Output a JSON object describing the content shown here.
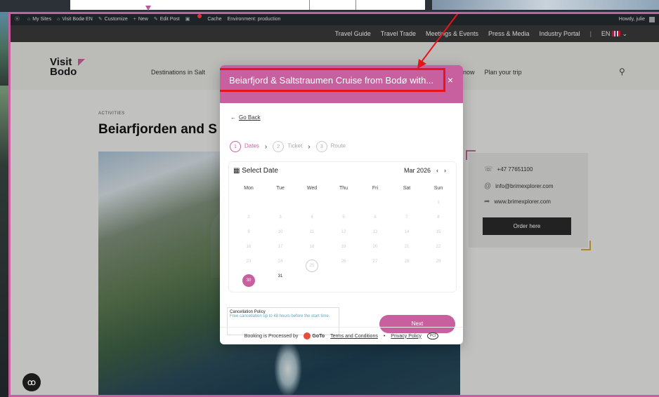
{
  "admin_bar": {
    "items": [
      "My Sites",
      "Visit Bodø EN",
      "Customize",
      "New",
      "Edit Post",
      "Cache",
      "Environment: production"
    ],
    "greeting": "Howdy, julie"
  },
  "top_nav": {
    "items": [
      "Travel Guide",
      "Travel Trade",
      "Meetings & Events",
      "Press & Media",
      "Industry Portal"
    ],
    "language": "EN"
  },
  "header": {
    "logo_line1": "Visit",
    "logo_line2": "Bodo",
    "nav_left": "Destinations in Salt",
    "nav_right": [
      "now",
      "Plan your trip"
    ]
  },
  "page": {
    "category": "ACTIVITIES",
    "title": "Beiarfjorden and S"
  },
  "contact": {
    "phone": "+47 77651100",
    "email": "info@brimexplorer.com",
    "website": "www.brimexplorer.com",
    "order_label": "Order here"
  },
  "modal": {
    "title": "Beiarfjord & Saltstraumen Cruise from Bodø with...",
    "close": "×",
    "back_label": "Go Back",
    "steps": [
      {
        "num": "1",
        "label": "Dates"
      },
      {
        "num": "2",
        "label": "Ticket"
      },
      {
        "num": "3",
        "label": "Route"
      }
    ],
    "calendar": {
      "heading": "Select Date",
      "month": "Mar 2026",
      "weekdays": [
        "Mon",
        "Tue",
        "Wed",
        "Thu",
        "Fri",
        "Sat",
        "Sun"
      ],
      "selected": "30",
      "today": "25"
    },
    "policy_title": "Cancellation Policy",
    "policy_text": "Free cancellation up to 48 hours before the start time.",
    "next_label": "Next",
    "footer": {
      "processed_by": "Booking is Processed by",
      "brand": "GoTo",
      "terms": "Terms and Conditions",
      "privacy": "Privacy Policy",
      "badge": "PCI"
    }
  },
  "colors": {
    "accent": "#c8609f",
    "highlight": "#e8141c"
  }
}
